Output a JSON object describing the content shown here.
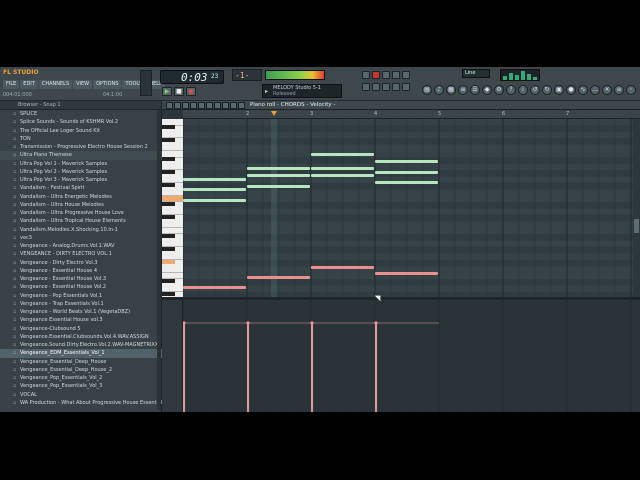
{
  "app": {
    "logo_text": "FL STUDIO",
    "menu": [
      "FILE",
      "EDIT",
      "CHANNELS",
      "VIEW",
      "OPTIONS",
      "TOOLS",
      "HELP"
    ],
    "info_left": "004:01:000",
    "info_right": "04:1:00"
  },
  "transport": {
    "time_main": "0:03",
    "time_ms": "23",
    "play_icon": "play-icon",
    "stop_icon": "stop-icon",
    "record_icon": "record-icon",
    "pattern_number": "-1-",
    "hint_line1": "MELODY Studio 5-1",
    "hint_line2": "Released",
    "line_mode": "Line"
  },
  "browser": {
    "header": "Browser - Snap 1",
    "items": [
      "SPLICE",
      "Splice Sounds - Sounds of KSHMR Vol.2",
      "The Official Lee Loger Sound Kit",
      "TON",
      "Transmission - Progressive Electro House Session 2",
      "Ultra Piano Themese",
      "Ultra Pop Vol 1 - Maverick Samples",
      "Ultra Pop Vol 2 - Maverick Samples",
      "Ultra Pop Vol 3 - Maverick Samples",
      "Vandalism - Festival Spirit",
      "Vandalism - Ultra Energetic Melodies",
      "Vandalism - Ultra House Melodies",
      "Vandalism - Ultra Progressive House Love",
      "Vandalism - Ultra Tropical House Elements",
      "Vandalism.Melodies.X.Shocking.10.in-1",
      "vec3",
      "Vengeance - Analog.Drums.Vol.1.WAV",
      "VENGEANCE - DIRTY ELECTRO VOL.1",
      "Vengeance - Dirty Electro Vol.3",
      "Vengeance - Essential House 4",
      "Vengeance - Essential House Vol.3",
      "Vengeance - Essential House Vol.2",
      "Vengeance - Pop Essentials Vol.1",
      "Vengeance - Trap Essentials Vol.1",
      "Vengeance - World Beats Vol.1 (VegetaDBZ)",
      "Vengeance Essential House vol.3",
      "Vengeance-Clubsound 5",
      "Vengeance.Essential.Clubsounds.Vol.4.WAV.ASSIGN",
      "Vengeance.Sound.Dirty.Electro.Vol.2.WAV-MAGNETRIXX",
      "Vengeance_EDM_Essentials_Vol_1",
      "Vengeance_Essential_Deep_House",
      "Vengeance_Essential_Deep_House_2",
      "Vengeance_Pop_Essentials_Vol_2",
      "Vengeance_Pop_Essentials_Vol_3",
      "VOCAL",
      "WA Production - What About Progressive House Essentials"
    ],
    "selected_index": 29
  },
  "piano_roll": {
    "title": "Piano roll - CHORDS - Velocity -",
    "bars": [
      "2",
      "3",
      "4",
      "5",
      "6",
      "7"
    ],
    "colors": {
      "upper_note": "#b6e6bf",
      "lower_note": "#ec8f8f",
      "velocity": "#e89a9a"
    },
    "notes": [
      {
        "bar": 1,
        "len": 1,
        "lane": "upper",
        "pitch": 9
      },
      {
        "bar": 1,
        "len": 1,
        "lane": "upper",
        "pitch": 12
      },
      {
        "bar": 1,
        "len": 1,
        "lane": "upper",
        "pitch": 15
      },
      {
        "bar": 1,
        "len": 1,
        "lane": "lower",
        "pitch": 0
      },
      {
        "bar": 2,
        "len": 1,
        "lane": "upper",
        "pitch": 18
      },
      {
        "bar": 2,
        "len": 1,
        "lane": "upper",
        "pitch": 16
      },
      {
        "bar": 2,
        "len": 1,
        "lane": "upper",
        "pitch": 13
      },
      {
        "bar": 2,
        "len": 1,
        "lane": "lower",
        "pitch": 3
      },
      {
        "bar": 3,
        "len": 1,
        "lane": "upper",
        "pitch": 22
      },
      {
        "bar": 3,
        "len": 1,
        "lane": "upper",
        "pitch": 18
      },
      {
        "bar": 3,
        "len": 1,
        "lane": "upper",
        "pitch": 16
      },
      {
        "bar": 3,
        "len": 1,
        "lane": "lower",
        "pitch": 6
      },
      {
        "bar": 4,
        "len": 1,
        "lane": "upper",
        "pitch": 20
      },
      {
        "bar": 4,
        "len": 1,
        "lane": "upper",
        "pitch": 17
      },
      {
        "bar": 4,
        "len": 1,
        "lane": "upper",
        "pitch": 14
      },
      {
        "bar": 4,
        "len": 1,
        "lane": "lower",
        "pitch": 4
      }
    ],
    "velocity_bars": [
      1,
      2,
      3,
      4
    ]
  }
}
